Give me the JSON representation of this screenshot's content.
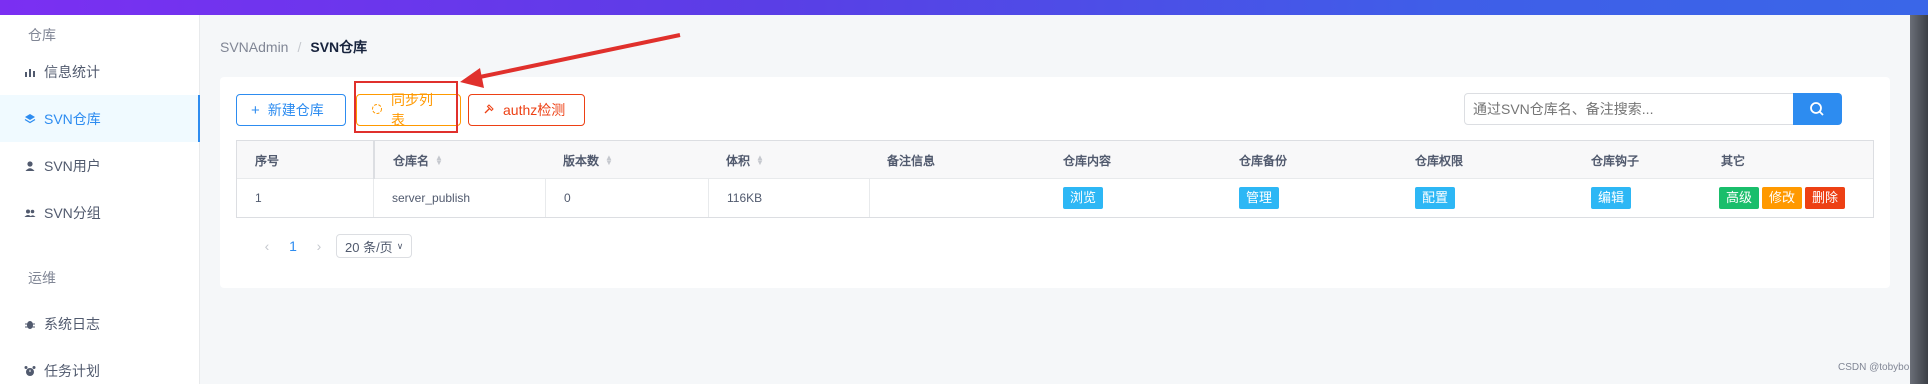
{
  "sidebar": {
    "group_repo": "仓库",
    "group_ops": "运维",
    "items": [
      {
        "label": "信息统计",
        "icon": "bar-chart-icon"
      },
      {
        "label": "SVN仓库",
        "icon": "stack-icon"
      },
      {
        "label": "SVN用户",
        "icon": "user-icon"
      },
      {
        "label": "SVN分组",
        "icon": "group-icon"
      },
      {
        "label": "系统日志",
        "icon": "bug-icon"
      },
      {
        "label": "任务计划",
        "icon": "alarm-icon"
      }
    ],
    "active_index": 1
  },
  "breadcrumb": {
    "root": "SVNAdmin",
    "separator": "/",
    "current": "SVN仓库"
  },
  "toolbar": {
    "new_label": "新建仓库",
    "sync_label": "同步列表",
    "auth_label": "authz检测"
  },
  "search": {
    "placeholder": "通过SVN仓库名、备注搜索..."
  },
  "table": {
    "headers": [
      "序号",
      "仓库名",
      "版本数",
      "体积",
      "备注信息",
      "仓库内容",
      "仓库备份",
      "仓库权限",
      "仓库钩子",
      "其它"
    ],
    "rows": [
      {
        "index": "1",
        "name": "server_publish",
        "revisions": "0",
        "size": "116KB",
        "note": "",
        "content_btn": "浏览",
        "backup_btn": "管理",
        "perm_btn": "配置",
        "hook_btn": "编辑",
        "advanced_btn": "高级",
        "edit_btn": "修改",
        "delete_btn": "删除"
      }
    ]
  },
  "pager": {
    "prev": "‹",
    "current": "1",
    "next": "›",
    "page_size": "20 条/页"
  },
  "credit": "CSDN @tobybo",
  "colors": {
    "primary": "#2d8cf0",
    "warning": "#ff9900",
    "error": "#ed4014",
    "success": "#19be6b",
    "info": "#2db7f5",
    "annotation": "#e0302c"
  }
}
